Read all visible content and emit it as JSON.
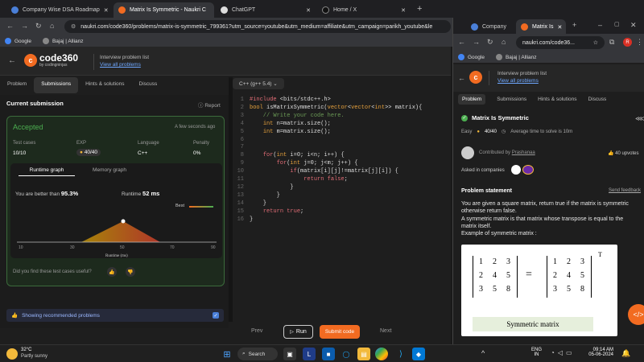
{
  "left_browser": {
    "tabs": [
      {
        "label": "Company Wise DSA Roadmap",
        "active": false
      },
      {
        "label": "Matrix Is Symmetric - Naukri C",
        "active": true
      },
      {
        "label": "ChatGPT",
        "active": false
      },
      {
        "label": "Home / X",
        "active": false
      }
    ],
    "new_tab": "+",
    "url": "naukri.com/code360/problems/matrix-is-symmetric_799361?utm_source=youtube&utm_medium=affiliate&utm_campaign=parikh_youtube&le",
    "bookmarks": [
      "Google",
      "Bajaj | Allianz"
    ]
  },
  "app": {
    "logo_main": "code",
    "logo_num": "360",
    "logo_sub": "by codingninjas",
    "interview_label": "Interview problem list",
    "view_all": "View all problems",
    "subtabs": [
      "Problem",
      "Submissions",
      "Hints & solutions",
      "Discuss"
    ],
    "active_subtab": "Submissions",
    "current_submission": "Current submission",
    "report": "Report",
    "status": "Accepted",
    "time_ago": "A few seconds ago",
    "stats_headers": [
      "Test cases",
      "EXP",
      "Language",
      "Penalty"
    ],
    "stats_values": [
      "10/10",
      "40/40",
      "C++",
      "0%"
    ],
    "graph_tabs": [
      "Runtime graph",
      "Memory graph"
    ],
    "better_label": "You are better than",
    "better_value": "95.3%",
    "runtime_label": "Runtime",
    "runtime_value": "52 ms",
    "best_label": "Best",
    "x_ticks": [
      "10",
      "30",
      "50",
      "70",
      "90"
    ],
    "x_axis_label": "Runtime (ms)",
    "feedback": "Did you find these test cases useful?",
    "recommended": "Showing recommended problems",
    "language_select": "C++ (g++ 5.4)",
    "prev": "Prev",
    "run": "Run",
    "submit": "Submit code",
    "next": "Next"
  },
  "code_lines": [
    "#include <bits/stdc++.h>",
    "bool isMatrixSymmetric(vector<vector<int>> matrix){",
    "    // Write your code here.",
    "    int n=matrix.size();",
    "    int m=matrix.size();",
    "",
    "",
    "    for(int i=0; i<n; i++) {",
    "        for(int j=0; j<m; j++) {",
    "            if(matrix[i][j]!=matrix[j][i]) {",
    "                return false;",
    "            }",
    "        }",
    "    }",
    "    return true;",
    "}"
  ],
  "right_browser": {
    "tabs": [
      "Company",
      "Matrix Is"
    ],
    "url": "naukri.com/code36...",
    "bookmarks": [
      "Google",
      "Bajaj | Allianz"
    ],
    "interview_label": "Interview problem list",
    "view_all": "View all problems",
    "subtabs": [
      "Problem",
      "Submissions",
      "Hints & solutions",
      "Discuss"
    ],
    "problem_title": "Matrix Is Symmetric",
    "difficulty": "Easy",
    "exp": "40/40",
    "avg_time": "Average time to solve is 10m",
    "contributed_by_label": "Contributed by",
    "contributor": "Prashanaa",
    "upvotes": "40 upvotes",
    "asked_in": "Asked in companies",
    "problem_statement": "Problem statement",
    "send_feedback": "Send feedback",
    "statement_lines": [
      "You are given a square matrix, return true if the matrix is symmetric",
      "otherwise return false.",
      "A symmetric matrix is that matrix whose transpose is equal to the",
      "matrix itself.",
      "Example of symmetric matrix :"
    ],
    "matrix_left": [
      [
        "1",
        "2",
        "3"
      ],
      [
        "2",
        "4",
        "5"
      ],
      [
        "3",
        "5",
        "8"
      ]
    ],
    "matrix_right": [
      [
        "1",
        "2",
        "3"
      ],
      [
        "2",
        "4",
        "5"
      ],
      [
        "3",
        "5",
        "8"
      ]
    ],
    "transpose_mark": "T",
    "equals": "=",
    "caption": "Symmetric matrix"
  },
  "taskbar": {
    "temp": "32°C",
    "weather": "Partly sunny",
    "search": "Search",
    "lang": "ENG",
    "region": "IN",
    "time": "09:14 AM",
    "date": "05-06-2024"
  },
  "colors": {
    "accent": "#f26b21",
    "accepted": "#4caf50",
    "chart_fill": "#b8860b"
  }
}
